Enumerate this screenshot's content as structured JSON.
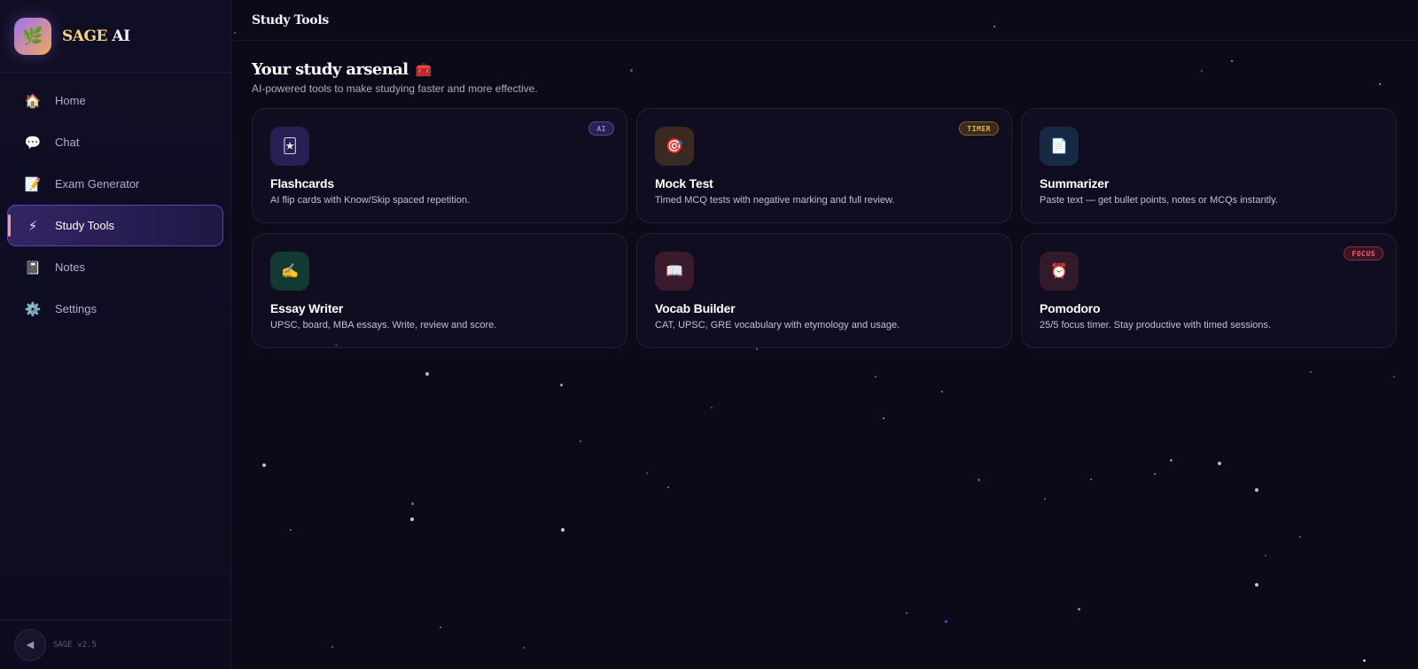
{
  "app": {
    "brand_main": "SAGE",
    "brand_suffix": "AI",
    "logo_icon": "leaf-icon",
    "version": "SAGE v2.5"
  },
  "sidebar": {
    "items": [
      {
        "label": "Home",
        "icon": "🏠",
        "icon_name": "house-icon",
        "active": false
      },
      {
        "label": "Chat",
        "icon": "💬",
        "icon_name": "speech-bubble-icon",
        "active": false
      },
      {
        "label": "Exam Generator",
        "icon": "📝",
        "icon_name": "memo-icon",
        "active": false
      },
      {
        "label": "Study Tools",
        "icon": "⚡",
        "icon_name": "lightning-icon",
        "active": true
      },
      {
        "label": "Notes",
        "icon": "📓",
        "icon_name": "notebook-icon",
        "active": false
      },
      {
        "label": "Settings",
        "icon": "⚙️",
        "icon_name": "gear-icon",
        "active": false
      }
    ],
    "collapse_icon": "◀"
  },
  "header": {
    "title": "Study Tools"
  },
  "main": {
    "heading": "Your study arsenal",
    "heading_emoji": "🧰",
    "subheading": "AI-powered tools to make studying faster and more effective."
  },
  "tools": [
    {
      "title": "Flashcards",
      "desc": "AI flip cards with Know/Skip spaced repetition.",
      "icon": "🃏",
      "icon_name": "flashcard-icon",
      "icon_bg": "#2a1f55",
      "badge": "AI",
      "badge_color": "#9d7cf2",
      "badge_bg": "#2b2150"
    },
    {
      "title": "Mock Test",
      "desc": "Timed MCQ tests with negative marking and full review.",
      "icon": "🎯",
      "icon_name": "target-icon",
      "icon_bg": "#3a2a22",
      "badge": "TIMER",
      "badge_color": "#e6b45a",
      "badge_bg": "#3a2d18"
    },
    {
      "title": "Summarizer",
      "desc": "Paste text — get bullet points, notes or MCQs instantly.",
      "icon": "📄",
      "icon_name": "document-icon",
      "icon_bg": "#162a45",
      "badge": "",
      "badge_color": "",
      "badge_bg": ""
    },
    {
      "title": "Essay Writer",
      "desc": "UPSC, board, MBA essays. Write, review and score.",
      "icon": "✍️",
      "icon_name": "writing-hand-icon",
      "icon_bg": "#123a33",
      "badge": "",
      "badge_color": "",
      "badge_bg": ""
    },
    {
      "title": "Vocab Builder",
      "desc": "CAT, UPSC, GRE vocabulary with etymology and usage.",
      "icon": "📖",
      "icon_name": "open-book-icon",
      "icon_bg": "#3a1a2c",
      "badge": "",
      "badge_color": "",
      "badge_bg": ""
    },
    {
      "title": "Pomodoro",
      "desc": "25/5 focus timer. Stay productive with timed sessions.",
      "icon": "⏰",
      "icon_name": "alarm-clock-icon",
      "icon_bg": "#331a2a",
      "badge": "FOCUS",
      "badge_color": "#f0607a",
      "badge_bg": "#3a1422"
    }
  ]
}
